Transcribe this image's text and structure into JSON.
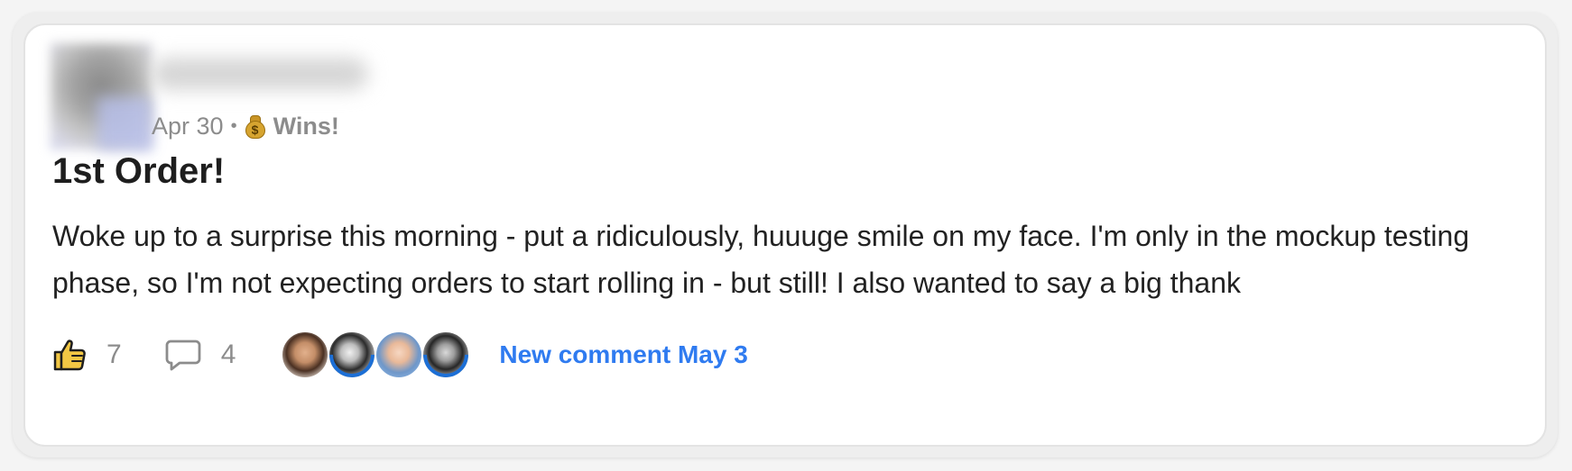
{
  "post": {
    "date": "Apr 30",
    "separator": "•",
    "category_icon": "money-bag-icon",
    "category": "Wins!",
    "title": "1st Order!",
    "body": "Woke up to a surprise this morning - put a ridiculously, huuuge smile on my face. I'm only in the mockup testing phase, so I'm not expecting orders to start rolling in - but still! I also wanted to say a big thank"
  },
  "actions": {
    "like_icon": "thumbs-up-icon",
    "like_count": "7",
    "comment_icon": "speech-bubble-icon",
    "comment_count": "4",
    "commenter_avatars": [
      "avatar-1",
      "avatar-2",
      "avatar-3",
      "avatar-4"
    ],
    "new_comment_label": "New comment May 3"
  },
  "colors": {
    "accent": "#2f7bf0",
    "like_icon_fill": "#f2c744",
    "muted_text": "#8c8c8c"
  }
}
